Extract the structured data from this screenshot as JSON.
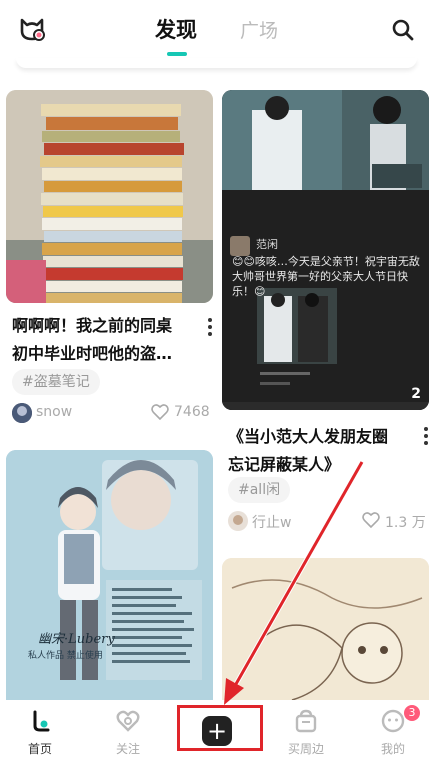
{
  "header": {
    "tabs": [
      {
        "label": "发现",
        "active": true
      },
      {
        "label": "广场",
        "active": false
      }
    ],
    "left_icon": "cat-badge-icon",
    "right_icon": "search-icon",
    "accent": "#16c7b4"
  },
  "feed": {
    "left": [
      {
        "title_line1": "啊啊啊！我之前的同桌",
        "title_line2": "初中毕业时吧他的盗…",
        "tag": "#盗墓笔记",
        "author": "snow",
        "likes": "7468"
      },
      {
        "image_text_1": "幽宋·Lubery",
        "image_text_2": "私人作品 禁止使用"
      }
    ],
    "right": [
      {
        "post_author": "范闲",
        "post_text": "😊😊咳咳…今天是父亲节！祝宇宙无敌大帅哥世界第一好的父亲大人节日快乐！😊",
        "photo_count": "2",
        "title_line1": "《当小范大人发朋友圈",
        "title_line2": "忘记屏蔽某人》",
        "tag": "#all闲",
        "author": "行止w",
        "likes": "1.3 万"
      }
    ]
  },
  "nav": {
    "items": [
      {
        "label": "首页",
        "icon": "home-icon"
      },
      {
        "label": "关注",
        "icon": "follow-icon"
      },
      {
        "label": "",
        "icon": "add-icon"
      },
      {
        "label": "买周边",
        "icon": "shop-icon"
      },
      {
        "label": "我的",
        "icon": "profile-icon"
      }
    ],
    "badge": "3"
  }
}
